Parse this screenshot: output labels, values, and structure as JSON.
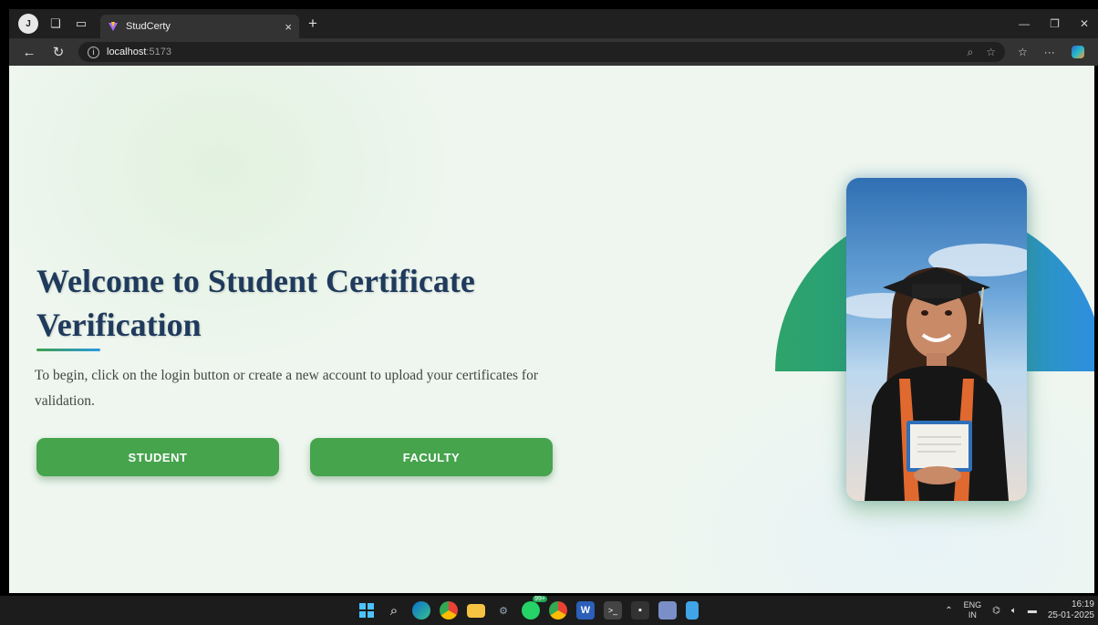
{
  "browser": {
    "tab_title": "StudCerty",
    "url_host": "localhost",
    "url_port": ":5173"
  },
  "page": {
    "hero_title": "Welcome to Student Certificate Verification",
    "hero_subtitle": "To begin, click on the login button or create a new account to upload your certificates for validation.",
    "buttons": {
      "student": "STUDENT",
      "faculty": "FACULTY"
    },
    "accent_green": "#46a44d",
    "title_color": "#1f3a5c"
  },
  "taskbar": {
    "apps": [
      "start-icon",
      "search-icon",
      "edge-icon",
      "chrome-icon",
      "file-explorer-icon",
      "settings-icon",
      "whatsapp-icon",
      "chrome-profile-icon",
      "word-icon",
      "terminal-icon",
      "app-icon",
      "snipping-icon",
      "notepad-icon"
    ],
    "whatsapp_badge": "99+",
    "lang_top": "ENG",
    "lang_bottom": "IN",
    "time": "16:19",
    "date": "25-01-2025"
  }
}
